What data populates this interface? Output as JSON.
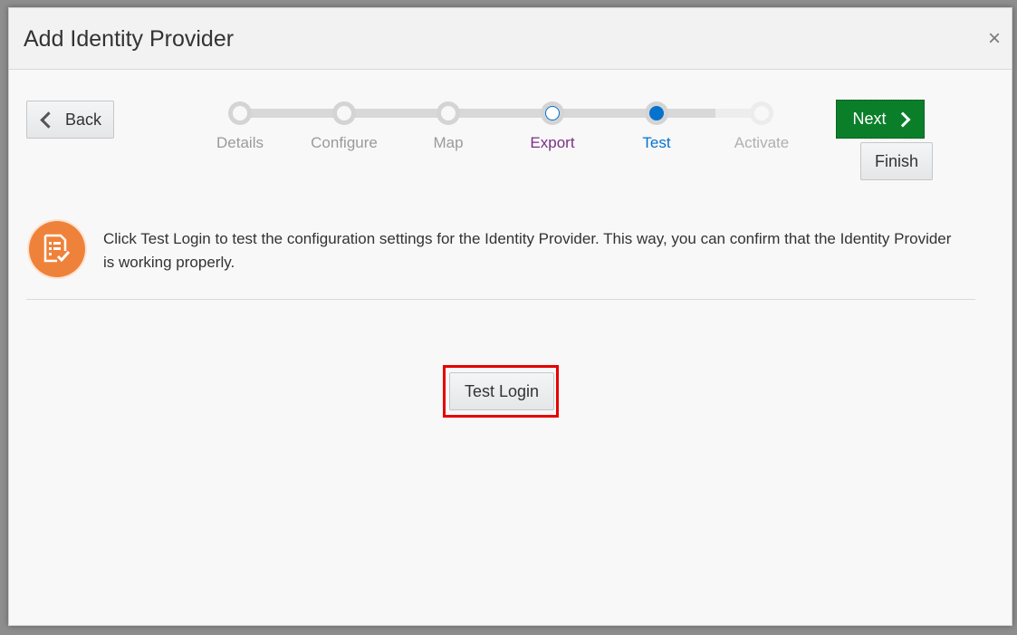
{
  "dialog": {
    "title": "Add Identity Provider",
    "close_glyph": "×"
  },
  "nav": {
    "back_label": "Back",
    "next_label": "Next",
    "finish_label": "Finish"
  },
  "train": {
    "steps": [
      {
        "label": "Details",
        "state": "visited"
      },
      {
        "label": "Configure",
        "state": "visited"
      },
      {
        "label": "Map",
        "state": "visited"
      },
      {
        "label": "Export",
        "state": "visited-unfocused"
      },
      {
        "label": "Test",
        "state": "current"
      },
      {
        "label": "Activate",
        "state": "unvisited"
      }
    ]
  },
  "info": {
    "icon": "checklist-icon",
    "message": "Click Test Login to test the configuration settings for the Identity Provider. This way, you can confirm that the Identity Provider is working properly."
  },
  "actions": {
    "test_login_label": "Test Login"
  },
  "colors": {
    "accent_blue": "#0572ce",
    "next_green": "#0b7e2a",
    "icon_orange": "#ef823b",
    "highlight_red": "#e60000",
    "export_purple": "#7a2f86"
  }
}
